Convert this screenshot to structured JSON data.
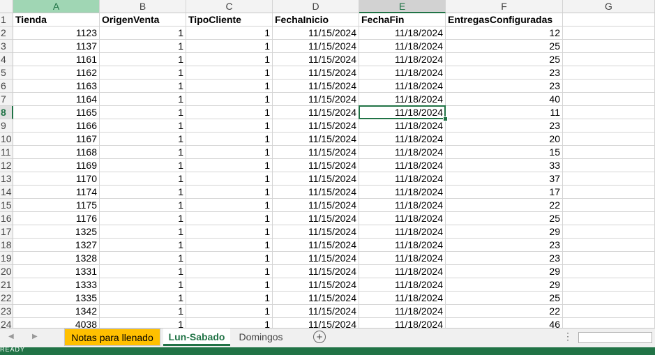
{
  "columns": [
    "A",
    "B",
    "C",
    "D",
    "E",
    "F",
    "G"
  ],
  "headers": [
    "Tienda",
    "OrigenVenta",
    "TipoCliente",
    "FechaInicio",
    "FechaFin",
    "EntregasConfiguradas"
  ],
  "rows": [
    [
      "1123",
      "1",
      "1",
      "11/15/2024",
      "11/18/2024",
      "12"
    ],
    [
      "1137",
      "1",
      "1",
      "11/15/2024",
      "11/18/2024",
      "25"
    ],
    [
      "1161",
      "1",
      "1",
      "11/15/2024",
      "11/18/2024",
      "25"
    ],
    [
      "1162",
      "1",
      "1",
      "11/15/2024",
      "11/18/2024",
      "23"
    ],
    [
      "1163",
      "1",
      "1",
      "11/15/2024",
      "11/18/2024",
      "23"
    ],
    [
      "1164",
      "1",
      "1",
      "11/15/2024",
      "11/18/2024",
      "40"
    ],
    [
      "1165",
      "1",
      "1",
      "11/15/2024",
      "11/18/2024",
      "11"
    ],
    [
      "1166",
      "1",
      "1",
      "11/15/2024",
      "11/18/2024",
      "23"
    ],
    [
      "1167",
      "1",
      "1",
      "11/15/2024",
      "11/18/2024",
      "20"
    ],
    [
      "1168",
      "1",
      "1",
      "11/15/2024",
      "11/18/2024",
      "15"
    ],
    [
      "1169",
      "1",
      "1",
      "11/15/2024",
      "11/18/2024",
      "33"
    ],
    [
      "1170",
      "1",
      "1",
      "11/15/2024",
      "11/18/2024",
      "37"
    ],
    [
      "1174",
      "1",
      "1",
      "11/15/2024",
      "11/18/2024",
      "17"
    ],
    [
      "1175",
      "1",
      "1",
      "11/15/2024",
      "11/18/2024",
      "22"
    ],
    [
      "1176",
      "1",
      "1",
      "11/15/2024",
      "11/18/2024",
      "25"
    ],
    [
      "1325",
      "1",
      "1",
      "11/15/2024",
      "11/18/2024",
      "29"
    ],
    [
      "1327",
      "1",
      "1",
      "11/15/2024",
      "11/18/2024",
      "23"
    ],
    [
      "1328",
      "1",
      "1",
      "11/15/2024",
      "11/18/2024",
      "23"
    ],
    [
      "1331",
      "1",
      "1",
      "11/15/2024",
      "11/18/2024",
      "29"
    ],
    [
      "1333",
      "1",
      "1",
      "11/15/2024",
      "11/18/2024",
      "29"
    ],
    [
      "1335",
      "1",
      "1",
      "11/15/2024",
      "11/18/2024",
      "25"
    ],
    [
      "1342",
      "1",
      "1",
      "11/15/2024",
      "11/18/2024",
      "22"
    ],
    [
      "4038",
      "1",
      "1",
      "11/15/2024",
      "11/18/2024",
      "46"
    ]
  ],
  "row_numbers": [
    "1",
    "2",
    "3",
    "4",
    "5",
    "6",
    "7",
    "8",
    "9",
    "10",
    "11",
    "12",
    "13",
    "14",
    "15",
    "16",
    "17",
    "18",
    "19",
    "20",
    "21",
    "22",
    "23",
    "24"
  ],
  "selection": {
    "active_column": "E",
    "active_row": "8"
  },
  "tabs": {
    "nav_prev": "◀",
    "nav_next": "▶",
    "items": [
      "Notas para llenado",
      "Lun-Sabado",
      "Domingos"
    ],
    "add_label": "+",
    "more_label": "⋮"
  },
  "status": {
    "text": "READY"
  },
  "colors": {
    "accent": "#217346",
    "tab_highlight": "#ffc000"
  }
}
